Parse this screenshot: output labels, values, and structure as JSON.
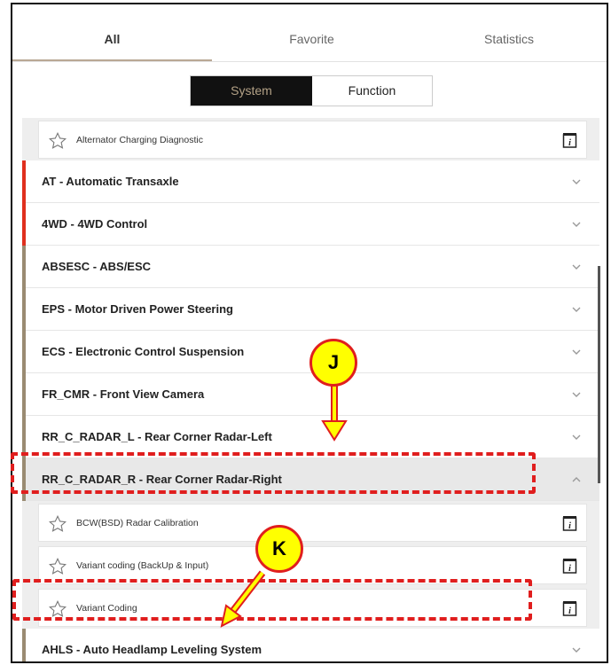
{
  "tabs": [
    "All",
    "Favorite",
    "Statistics"
  ],
  "segment": {
    "system": "System",
    "function": "Function"
  },
  "top_sub": {
    "label": "Alternator Charging Diagnostic"
  },
  "rows": [
    {
      "label": "AT - Automatic Transaxle",
      "bar_color": "#e0301e"
    },
    {
      "label": "4WD - 4WD Control",
      "bar_color": "#e0301e"
    },
    {
      "label": "ABSESC - ABS/ESC",
      "bar_color": "#9a8b72"
    },
    {
      "label": "EPS - Motor Driven Power Steering",
      "bar_color": "#9a8b72"
    },
    {
      "label": "ECS - Electronic Control Suspension",
      "bar_color": "#9a8b72"
    },
    {
      "label": "FR_CMR - Front View Camera",
      "bar_color": "#9a8b72"
    },
    {
      "label": "RR_C_RADAR_L - Rear Corner Radar-Left",
      "bar_color": "#9a8b72"
    },
    {
      "label": "RR_C_RADAR_R - Rear Corner Radar-Right",
      "bar_color": "#9a8b72"
    }
  ],
  "sub_items": [
    {
      "label": "BCW(BSD) Radar Calibration"
    },
    {
      "label": "Variant coding (BackUp & Input)"
    },
    {
      "label": "Variant Coding"
    }
  ],
  "last_row": {
    "label": "AHLS - Auto Headlamp Leveling System",
    "bar_color": "#9a8b72"
  },
  "callouts": {
    "j": "J",
    "k": "K"
  },
  "colors": {
    "accent": "#b3a186",
    "highlight": "#e01e1e",
    "callout_fill": "#ffff00"
  }
}
